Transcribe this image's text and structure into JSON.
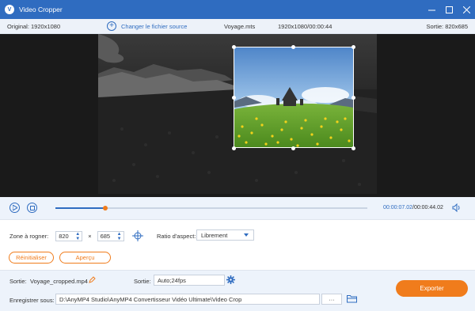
{
  "window": {
    "title": "Video Cropper",
    "app_icon": "V",
    "controls": [
      "minimize-icon",
      "maximize-icon",
      "close-icon"
    ]
  },
  "info": {
    "original": "Original: 1920x1080",
    "change_source": "Changer le fichier source",
    "file_name": "Voyage.mts",
    "resolution_duration": "1920x1080/00:00:44",
    "output": "Sortie: 820x685"
  },
  "playback": {
    "current_time": "00:00:07.02",
    "separator": "/",
    "total_time": "00:00:44.02",
    "progress": 0.16
  },
  "crop": {
    "zone_label": "Zone à rogner:",
    "width": "820",
    "times": "×",
    "height": "685",
    "aspect_label": "Ratio d'aspect:",
    "aspect_value": "Librement",
    "reset_button": "Réinitialiser",
    "preview_button": "Aperçu"
  },
  "output": {
    "name_label": "Sortie:",
    "file_name": "Voyage_cropped.mp4",
    "format_label": "Sortie:",
    "format_value": "Auto;24fps",
    "save_label": "Enregistrer sous:",
    "save_path": "D:\\AnyMP4 Studio\\AnyMP4 Convertisseur Vidéo Ultimate\\Video Crop",
    "more": "···",
    "export_button": "Exporter"
  },
  "colors": {
    "titlebar": "#2f6cc0",
    "accent": "#2f6cc0",
    "orange": "#f07c1c"
  }
}
